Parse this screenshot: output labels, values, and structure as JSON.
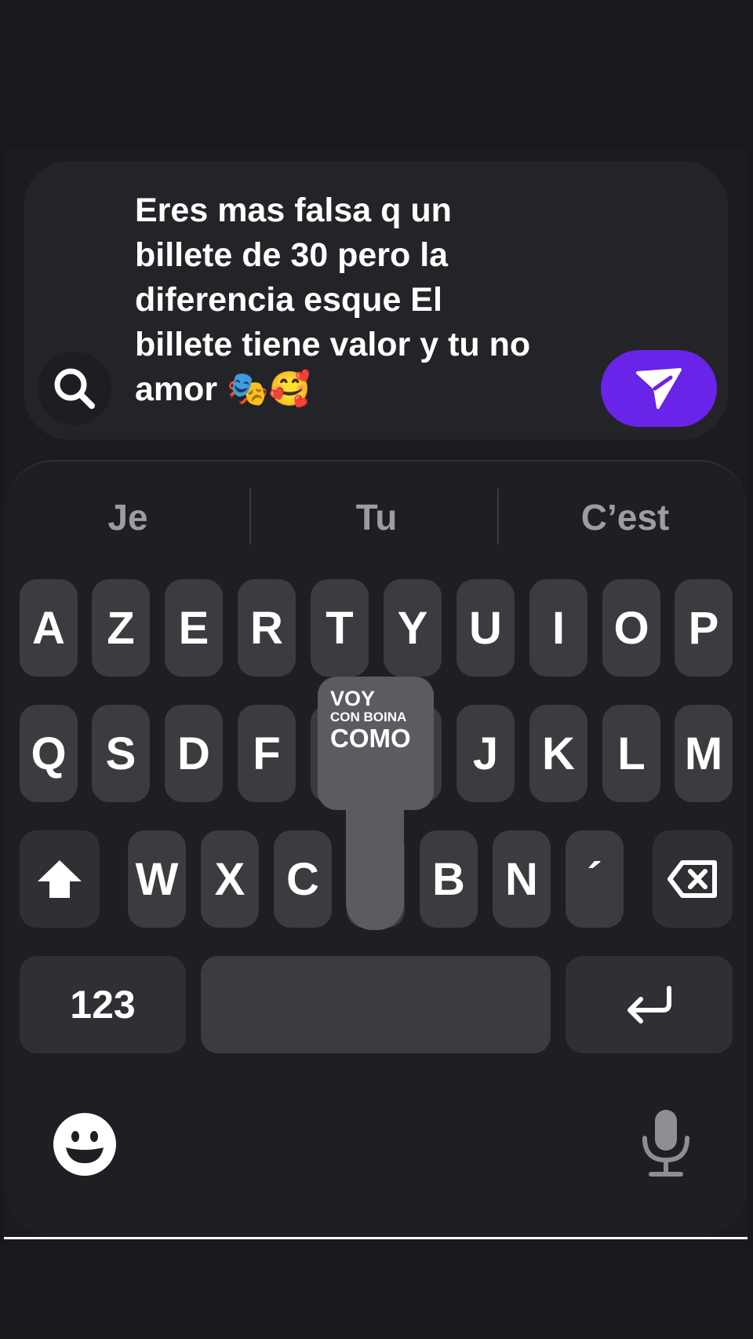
{
  "message": {
    "text": "Eres mas falsa q un\nbillete de 30 pero la\ndiferencia esque El\nbillete tiene valor y tu no\namor 🎭🥰"
  },
  "icons": {
    "search": "search-icon",
    "send": "send-icon",
    "shift": "shift-icon",
    "backspace": "backspace-icon",
    "return": "return-icon",
    "emoji": "emoji-icon",
    "mic": "microphone-icon"
  },
  "colors": {
    "accent": "#6a23e8",
    "key": "#3b3c40",
    "background": "#18191c"
  },
  "suggestions": [
    "Je",
    "Tu",
    "C’est"
  ],
  "keys": {
    "row1": [
      "A",
      "Z",
      "E",
      "R",
      "T",
      "Y",
      "U",
      "I",
      "O",
      "P"
    ],
    "row2": [
      "Q",
      "S",
      "D",
      "F",
      "J",
      "K",
      "L",
      "M"
    ],
    "row3": [
      "W",
      "X",
      "C",
      "B",
      "N",
      "´"
    ],
    "numbers": "123"
  },
  "tooltip": {
    "line1": "VOY",
    "line2": "CON BOINA",
    "line3": "COMO"
  }
}
